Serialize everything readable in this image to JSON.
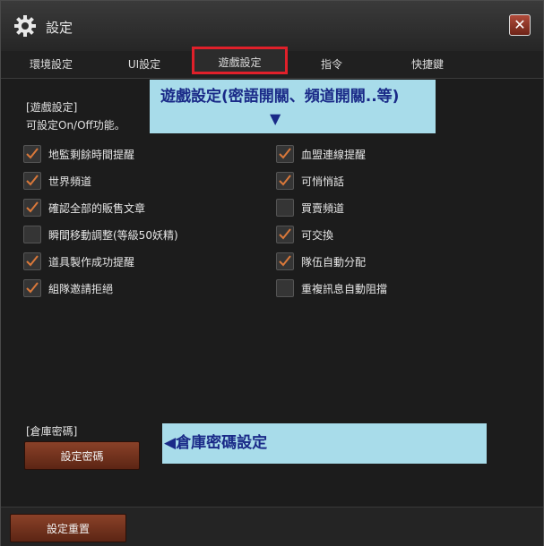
{
  "window": {
    "title": "設定",
    "gear_icon": "gear-icon",
    "close_icon": "close-icon",
    "close_glyph": "✕"
  },
  "tabs": [
    {
      "label": "環境設定",
      "active": false
    },
    {
      "label": "UI設定",
      "active": false
    },
    {
      "label": "遊戲設定",
      "active": true
    },
    {
      "label": "指令",
      "active": false
    },
    {
      "label": "快捷鍵",
      "active": false
    }
  ],
  "annotations": {
    "game_settings": "遊戲設定(密語開關、頻道開關..等)",
    "game_settings_arrow": "▼",
    "warehouse_password": "◀倉庫密碼設定"
  },
  "game_section": {
    "label": "[遊戲設定]",
    "description": "可設定On/Off功能。"
  },
  "options_left": [
    {
      "label": "地監剩餘時間提醒",
      "checked": true
    },
    {
      "label": "世界頻道",
      "checked": true
    },
    {
      "label": "確認全部的販售文章",
      "checked": true
    },
    {
      "label": "瞬間移動調整(等級50妖精)",
      "checked": false
    },
    {
      "label": "道具製作成功提醒",
      "checked": true
    },
    {
      "label": "組隊邀請拒絕",
      "checked": true
    }
  ],
  "options_right": [
    {
      "label": "血盟連線提醒",
      "checked": true
    },
    {
      "label": "可悄悄話",
      "checked": true
    },
    {
      "label": "買賣頻道",
      "checked": false
    },
    {
      "label": "可交換",
      "checked": true
    },
    {
      "label": "隊伍自動分配",
      "checked": true
    },
    {
      "label": "重複訊息自動阻擋",
      "checked": false
    }
  ],
  "warehouse": {
    "label": "[倉庫密碼]",
    "button": "設定密碼"
  },
  "footer": {
    "reset_button": "設定重置"
  },
  "colors": {
    "checkmark": "#d9783a",
    "annotation_bg": "#a8dcea",
    "annotation_text": "#1a2a88",
    "active_tab_border": "#e0202a",
    "button": "#7a3620"
  }
}
